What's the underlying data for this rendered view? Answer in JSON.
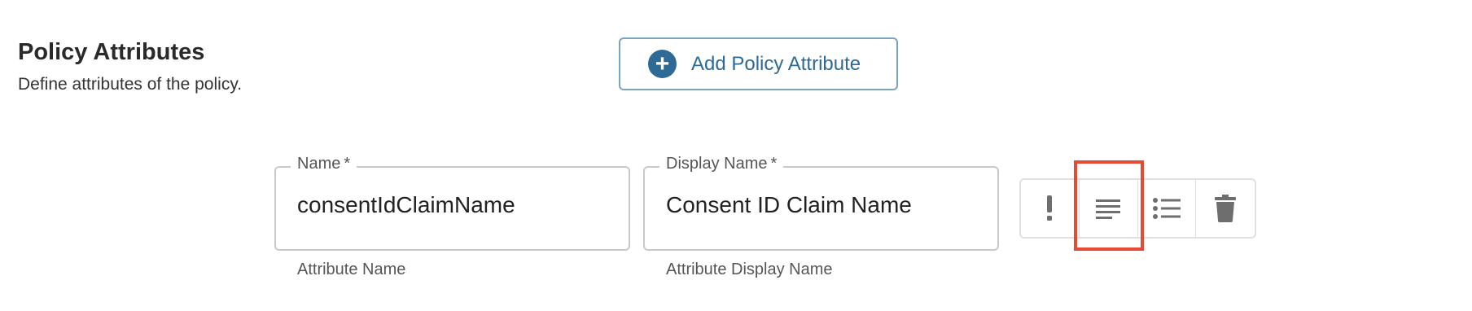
{
  "section": {
    "title": "Policy Attributes",
    "description": "Define attributes of the policy."
  },
  "add_button": {
    "label": "Add Policy Attribute",
    "icon": "plus-circle-icon"
  },
  "fields": {
    "name": {
      "label": "Name",
      "required_mark": "*",
      "value": "consentIdClaimName",
      "helper": "Attribute Name"
    },
    "display_name": {
      "label": "Display Name",
      "required_mark": "*",
      "value": "Consent ID Claim Name",
      "helper": "Attribute Display Name"
    }
  },
  "actions": [
    {
      "icon": "exclamation-icon"
    },
    {
      "icon": "text-lines-icon",
      "highlighted": true
    },
    {
      "icon": "bulleted-list-icon"
    },
    {
      "icon": "trash-icon"
    }
  ],
  "colors": {
    "accent": "#2d6a96",
    "highlight": "#e54a35",
    "icon": "#6e6e6e"
  }
}
